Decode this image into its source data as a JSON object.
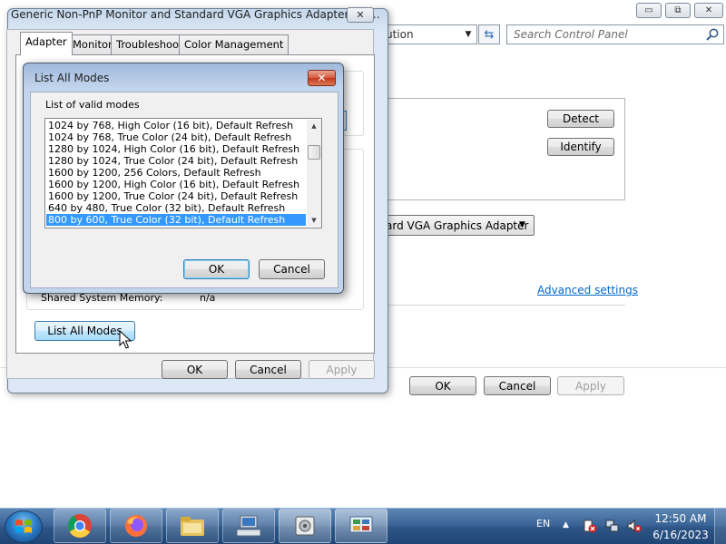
{
  "control_panel": {
    "address_text": "ution",
    "search_placeholder": "Search Control Panel",
    "detect_label": "Detect",
    "identify_label": "Identify",
    "adapter_select_value": "ard VGA Graphics Adapter",
    "advanced_link": "Advanced settings",
    "ok_label": "OK",
    "cancel_label": "Cancel",
    "apply_label": "Apply",
    "caption_minimize": "▭",
    "caption_maximize": "⧉",
    "caption_close": "✕"
  },
  "properties_dialog": {
    "title": "Generic Non-PnP Monitor and Standard VGA Graphics Adapter Pro...",
    "close_label": "✕",
    "tabs": [
      {
        "label": "Adapter",
        "active": true
      },
      {
        "label": "Monitor",
        "active": false
      },
      {
        "label": "Troubleshoot",
        "active": false
      },
      {
        "label": "Color Management",
        "active": false
      }
    ],
    "shared_memory_label": "Shared System Memory:",
    "shared_memory_value": "n/a",
    "list_all_modes_label": "List All Modes",
    "ok_label": "OK",
    "cancel_label": "Cancel",
    "apply_label": "Apply"
  },
  "modes_dialog": {
    "title": "List All Modes",
    "close_label": "✕",
    "list_label": "List of valid modes",
    "modes": [
      "1024 by 768, High Color (16 bit), Default Refresh",
      "1024 by 768, True Color (24 bit), Default Refresh",
      "1280 by 1024, High Color (16 bit), Default Refresh",
      "1280 by 1024, True Color (24 bit), Default Refresh",
      "1600 by 1200, 256 Colors, Default Refresh",
      "1600 by 1200, High Color (16 bit), Default Refresh",
      "1600 by 1200, True Color (24 bit), Default Refresh",
      "640 by 480, True Color (32 bit), Default Refresh",
      "800 by 600, True Color (32 bit), Default Refresh"
    ],
    "selected_index": 8,
    "ok_label": "OK",
    "cancel_label": "Cancel"
  },
  "taskbar": {
    "language": "EN",
    "time": "12:50 AM",
    "date": "6/16/2023",
    "apps": [
      "chrome-icon",
      "firefox-icon",
      "file-explorer-icon",
      "device-manager-icon",
      "disk-icon",
      "control-panel-icon"
    ]
  },
  "colors": {
    "selection": "#3399ff",
    "link": "#0066cc",
    "taskbar": "#2c5586"
  }
}
